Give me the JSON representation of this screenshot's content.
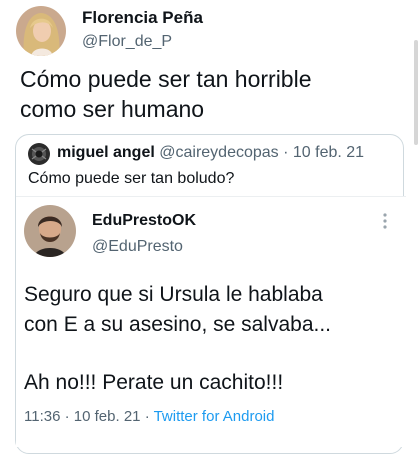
{
  "main_tweet": {
    "author_name": "Florencia Peña",
    "author_handle": "@Flor_de_P",
    "text_line1": "Cómo puede ser tan horrible",
    "text_line2": "como ser humano",
    "avatar_icon": "profile-photo-woman-blonde"
  },
  "quoted_tweet": {
    "author_name": "miguel angel",
    "author_handle": "@caireydecopas",
    "separator": "·",
    "date": "10 feb. 21",
    "text": "Cómo puede ser tan boludo?",
    "avatar_icon": "profile-photo-dark-round"
  },
  "embedded_tweet": {
    "author_name": "EduPrestoOK",
    "author_handle": "@EduPresto",
    "text_line1": "Seguro que si Ursula le hablaba",
    "text_line2": "con E a su asesino, se salvaba...",
    "text_line3": "Ah no!!! Perate un cachito!!!",
    "time": "11:36",
    "separator": "·",
    "date": "10 feb. 21",
    "source": "Twitter for Android",
    "avatar_icon": "profile-photo-man-beard",
    "more_icon": "more-vertical-icon"
  },
  "colors": {
    "text_primary": "#0f1419",
    "text_secondary": "#536471",
    "link": "#1d9bf0",
    "border": "#cfd9de"
  }
}
